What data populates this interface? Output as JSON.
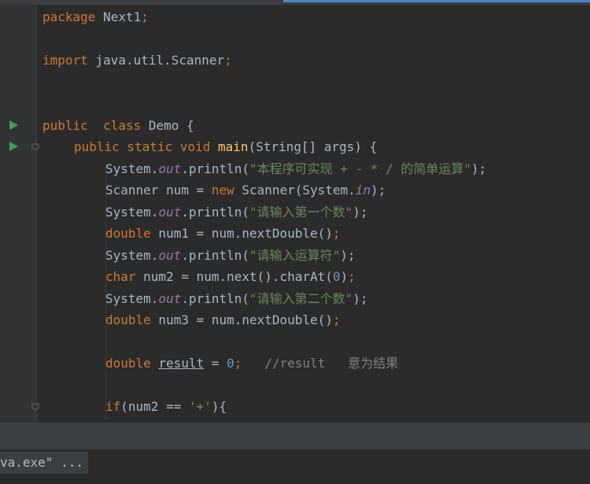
{
  "editor": {
    "language": "Java",
    "lines": {
      "pkg_kw": "package",
      "pkg_name": " Next1",
      "pkg_semi": ";",
      "imp_kw": "import",
      "imp_name": " java.util.Scanner",
      "imp_semi": ";",
      "cls_kw1": "public",
      "cls_kw2": "  class",
      "cls_rest": " Demo {",
      "main_kw": "public static void",
      "main_fn": " main",
      "main_rest": "(String[] args) {",
      "l1_a": "System.",
      "l1_out": "out",
      "l1_b": ".println(",
      "l1_str": "\"本程序可实现 + - * / 的简单运算\"",
      "l1_c": ");",
      "l2_a": "Scanner num = ",
      "l2_new": "new",
      "l2_b": " Scanner(System.",
      "l2_in": "in",
      "l2_c": ");",
      "l3_a": "System.",
      "l3_out": "out",
      "l3_b": ".println(",
      "l3_str": "\"请输入第一个数\"",
      "l3_c": ");",
      "l4_kw": "double",
      "l4_a": " num1 = num.nextDouble()",
      "l4_semi": ";",
      "l5_a": "System.",
      "l5_out": "out",
      "l5_b": ".println(",
      "l5_str": "\"请输入运算符\"",
      "l5_c": ");",
      "l6_kw": "char",
      "l6_a": " num2 = num.next().charAt(",
      "l6_num": "0",
      "l6_b": ")",
      "l6_semi": ";",
      "l7_a": "System.",
      "l7_out": "out",
      "l7_b": ".println(",
      "l7_str": "\"请输入第二个数\"",
      "l7_c": ");",
      "l8_kw": "double",
      "l8_a": " num3 = num.nextDouble()",
      "l8_semi": ";",
      "l9_kw": "double",
      "l9_sp": " ",
      "l9_var": "result",
      "l9_a": " = ",
      "l9_num": "0",
      "l9_semi": ";",
      "l9_cmt": "   //result   意为结果",
      "l10_kw": "if",
      "l10_a": "(num2 == ",
      "l10_str": "'+'",
      "l10_b": "){"
    }
  },
  "console": {
    "output": "va.exe\" ..."
  },
  "colors": {
    "background": "#2b2b2b",
    "keyword": "#cc7832",
    "string": "#6a8759",
    "number": "#6897bb",
    "static_field": "#9876aa",
    "method": "#ffc66d",
    "comment": "#808080",
    "run_icon": "#499c54"
  },
  "icons": {
    "run": "run-triangle-icon",
    "fold": "fold-marker-icon"
  }
}
